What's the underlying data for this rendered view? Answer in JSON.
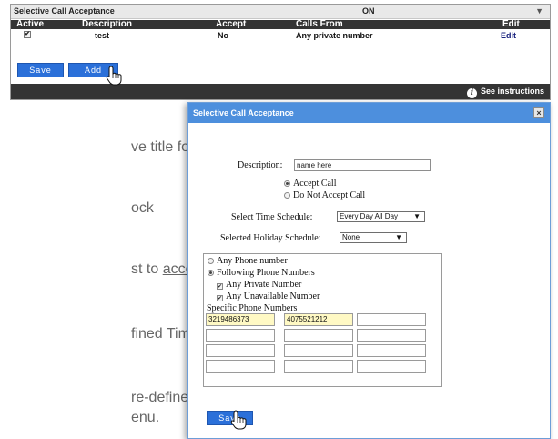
{
  "background_panel": {
    "title": "Selective Call Acceptance",
    "status": "ON",
    "dropdown_arrow": "▼",
    "columns": [
      "Active",
      "Description",
      "Accept",
      "Calls From",
      "Edit"
    ],
    "row": {
      "active_checked": true,
      "description": "test",
      "accept": "No",
      "calls_from": "Any private number",
      "edit": "Edit"
    },
    "save_label": "Save",
    "add_label": "Add",
    "see_instructions": "See instructions",
    "info_icon": "i"
  },
  "background_doc": {
    "lines": [
      "ve title for",
      "ock",
      "st to",
      "accept",
      "fined Time",
      "re-defined",
      "enu."
    ]
  },
  "dialog": {
    "title": "Selective Call Acceptance",
    "close_label": "×",
    "description_label": "Description:",
    "description_value": "name here",
    "accept_options": [
      {
        "label": "Accept Call",
        "selected": true
      },
      {
        "label": "Do Not Accept Call",
        "selected": false
      }
    ],
    "time_schedule_label": "Select Time Schedule:",
    "time_schedule_value": "Every Day All Day",
    "holiday_schedule_label": "Selected Holiday Schedule:",
    "holiday_schedule_value": "None",
    "caret": "▼",
    "number_options": [
      {
        "label": "Any Phone number",
        "selected": false
      },
      {
        "label": "Following Phone Numbers",
        "selected": true
      }
    ],
    "number_checkboxes": [
      {
        "label": "Any Private Number",
        "checked": true
      },
      {
        "label": "Any Unavailable Number",
        "checked": true
      }
    ],
    "specific_numbers_label": "Specific Phone Numbers",
    "specific_numbers": [
      [
        "3219486373",
        "4075521212",
        ""
      ],
      [
        "",
        "",
        ""
      ],
      [
        "",
        "",
        ""
      ],
      [
        "",
        "",
        ""
      ]
    ],
    "save_label": "Save"
  },
  "colors": {
    "button_blue": "#2b70d9",
    "dialog_title_blue": "#4d8fdd",
    "dark_bar": "#343434",
    "highlight_cell": "#fff9c4"
  },
  "icons": [
    "info-icon",
    "close-icon",
    "hand-cursor-icon",
    "checkbox-icon",
    "radio-icon",
    "dropdown-caret-icon"
  ]
}
